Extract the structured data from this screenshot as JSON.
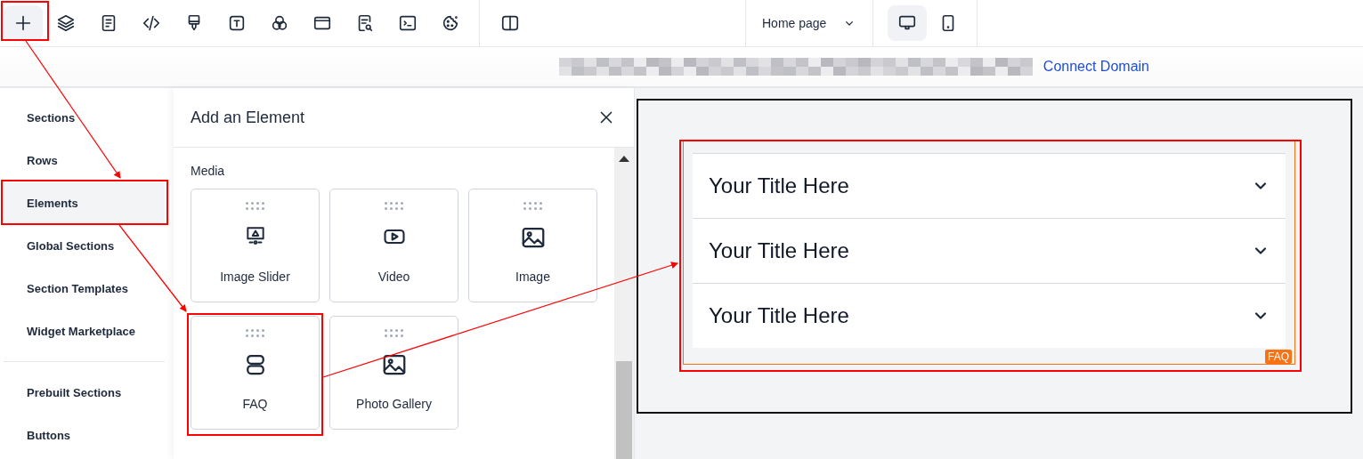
{
  "toolbar": {
    "tools": [
      {
        "kind": "add",
        "selected": true
      },
      {
        "kind": "layers",
        "selected": false
      },
      {
        "kind": "page",
        "selected": false
      },
      {
        "kind": "code",
        "selected": false
      },
      {
        "kind": "brush",
        "selected": false
      },
      {
        "kind": "text",
        "selected": false
      },
      {
        "kind": "colors",
        "selected": false
      },
      {
        "kind": "window",
        "selected": false
      },
      {
        "kind": "seo",
        "selected": false
      },
      {
        "kind": "terminal",
        "selected": false
      },
      {
        "kind": "cookie",
        "selected": false
      }
    ],
    "view_tools": [
      {
        "kind": "split",
        "selected": false
      }
    ],
    "page_select": {
      "value": "Home page"
    },
    "devices": [
      {
        "kind": "desktop",
        "selected": true
      },
      {
        "kind": "mobile",
        "selected": false
      }
    ]
  },
  "url_bar": {
    "link": "Connect Domain"
  },
  "sidebar": {
    "items": [
      {
        "label": "Sections",
        "selected": false
      },
      {
        "label": "Rows",
        "selected": false
      },
      {
        "label": "Elements",
        "selected": true
      },
      {
        "label": "Global Sections",
        "selected": false
      },
      {
        "label": "Section Templates",
        "selected": false
      },
      {
        "label": "Widget Marketplace",
        "selected": false
      }
    ],
    "more_items": [
      {
        "label": "Prebuilt Sections",
        "selected": false
      },
      {
        "label": "Buttons",
        "selected": false
      }
    ]
  },
  "panel": {
    "title": "Add an Element",
    "section": "Media",
    "elements": [
      {
        "kind": "slider",
        "label": "Image Slider"
      },
      {
        "kind": "video",
        "label": "Video"
      },
      {
        "kind": "image",
        "label": "Image"
      },
      {
        "kind": "faq",
        "label": "FAQ"
      },
      {
        "kind": "gallery",
        "label": "Photo Gallery"
      }
    ]
  },
  "canvas": {
    "faq": {
      "badge": "FAQ",
      "items": [
        {
          "title": "Your Title Here",
          "expanded": false
        },
        {
          "title": "Your Title Here",
          "expanded": false
        },
        {
          "title": "Your Title Here",
          "expanded": false
        }
      ]
    }
  }
}
